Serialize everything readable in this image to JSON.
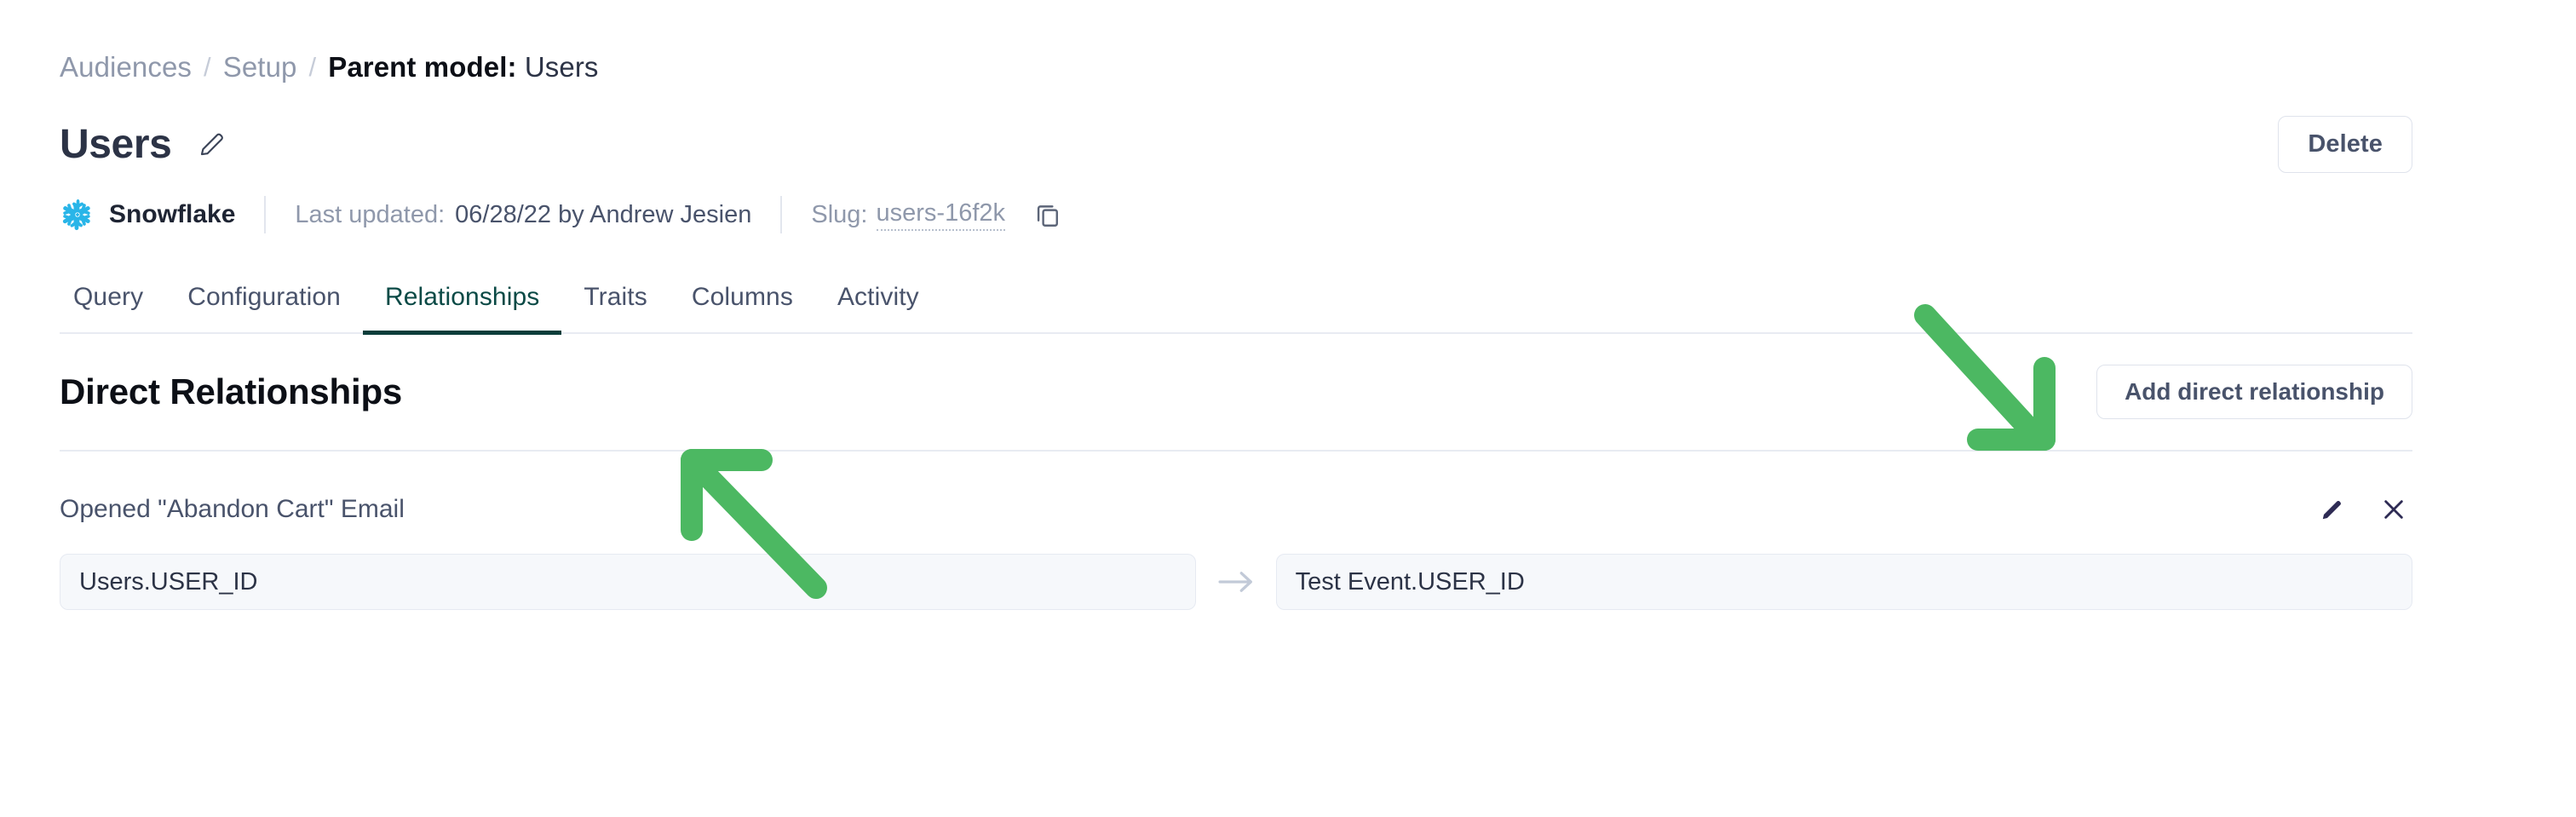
{
  "breadcrumb": {
    "items": [
      {
        "label": "Audiences",
        "current": false
      },
      {
        "label": "Setup",
        "current": false
      }
    ],
    "separator": "/",
    "current_prefix": "Parent model:",
    "current_object": "Users"
  },
  "header": {
    "title": "Users",
    "edit_icon": "pencil-icon",
    "delete_label": "Delete"
  },
  "meta": {
    "source_icon": "snowflake-icon",
    "source_name": "Snowflake",
    "last_updated_label": "Last updated:",
    "last_updated_value": "06/28/22 by Andrew Jesien",
    "slug_label": "Slug:",
    "slug_value": "users-16f2k",
    "copy_icon": "copy-icon"
  },
  "tabs": [
    {
      "label": "Query",
      "active": false
    },
    {
      "label": "Configuration",
      "active": false
    },
    {
      "label": "Relationships",
      "active": true
    },
    {
      "label": "Traits",
      "active": false
    },
    {
      "label": "Columns",
      "active": false
    },
    {
      "label": "Activity",
      "active": false
    }
  ],
  "section": {
    "title": "Direct Relationships",
    "add_button_label": "Add direct relationship"
  },
  "relationships": [
    {
      "name": "Opened \"Abandon Cart\" Email",
      "edit_icon": "pencil-icon",
      "remove_icon": "close-icon",
      "left_field": "Users.USER_ID",
      "join_icon": "arrow-right-icon",
      "right_field": "Test Event.USER_ID"
    }
  ],
  "annotations": [
    {
      "name": "arrow-pointing-to-relationships-tab",
      "direction": "up-left",
      "color": "#4cb862"
    },
    {
      "name": "arrow-pointing-to-add-direct-relationship-button",
      "direction": "down-right",
      "color": "#4cb862"
    }
  ],
  "colors": {
    "accent_active_tab": "#0b3d3a",
    "snowflake_blue": "#29b5e8",
    "annotation_green": "#4cb862",
    "text_primary": "#2c3346",
    "text_muted": "#8f98ab",
    "field_bg": "#f6f8fb",
    "border": "#e8ebf2"
  }
}
